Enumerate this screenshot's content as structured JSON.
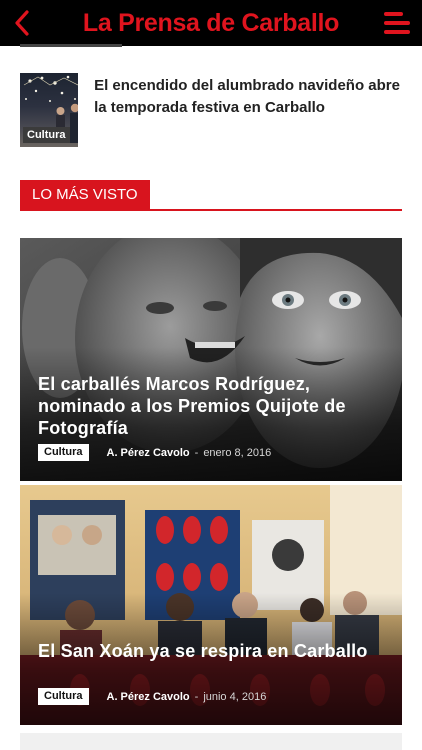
{
  "header": {
    "title": "La Prensa de Carballo",
    "back_icon": "chevron-left-icon",
    "menu_icon": "hamburger-menu-icon",
    "accent_color": "#e0141e"
  },
  "top_article": {
    "category": "Cultura",
    "title": "El encendido del alumbrado navideño abre la temporada festiva en Carballo"
  },
  "section": {
    "label": "LO MÁS VISTO"
  },
  "cards": [
    {
      "title": "El carballés Marcos Rodríguez, nominado a los Premios Quijote de Fotografía",
      "category": "Cultura",
      "author": "A. Pérez Cavolo",
      "separator": "-",
      "date": "enero 8, 2016"
    },
    {
      "title": "El San Xoán ya se respira en Carballo",
      "category": "Cultura",
      "author": "A. Pérez Cavolo",
      "separator": "-",
      "date": "junio 4, 2016"
    }
  ]
}
